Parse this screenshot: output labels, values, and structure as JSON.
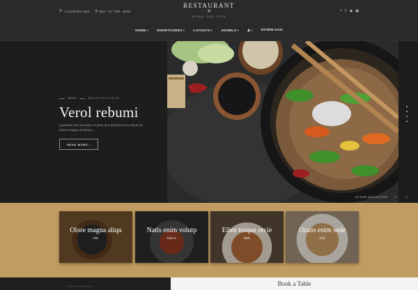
{
  "header": {
    "phone": "+1 (123) 872 4444",
    "hours": "Mon - Fri: 7:00 - 18:00",
    "logo_text": "RESTAURANT",
    "logo_tagline": "GLOBAL SOUL FOOD",
    "social_icons": [
      "facebook-icon",
      "twitter-icon",
      "pinterest-icon",
      "instagram-icon"
    ]
  },
  "nav": {
    "items": [
      {
        "label": "HOME",
        "has_caret": true
      },
      {
        "label": "SHORTCODES",
        "has_caret": true
      },
      {
        "label": "LAYOUTS",
        "has_caret": true
      },
      {
        "label": "JOOMLA",
        "has_caret": true
      },
      {
        "label": "",
        "icon": "user-icon",
        "has_caret": true
      },
      {
        "label": "DOWNLOAD",
        "has_caret": false
      }
    ]
  },
  "hero": {
    "category": "MENU",
    "datetime": "2016-07-04 21:16:16",
    "title": "Verol rebumi",
    "text": "Quaestat non accusam et justo duo dolores et ea rebum at dolore magna at dolore...",
    "button": "READ MORE ›",
    "slider_label": "SLIDER NAVIGATION",
    "prev_arrow": "←",
    "next_arrow": "→"
  },
  "cards": [
    {
      "title": "Olore magna aliqu",
      "sub": "Olor"
    },
    {
      "title": "Natis enim volutp",
      "sub": "Duis re"
    },
    {
      "title": "Ellen tesque orcie",
      "sub": "Malo"
    },
    {
      "title": "Oratis enim sede",
      "sub": "Grat"
    }
  ],
  "bottom": {
    "left_text": "Call For Reservations",
    "book_title": "Book a Table"
  },
  "colors": {
    "band": "#c19c62",
    "header_bg": "#2a2a2a",
    "hero_bg": "#1c1c1c"
  }
}
